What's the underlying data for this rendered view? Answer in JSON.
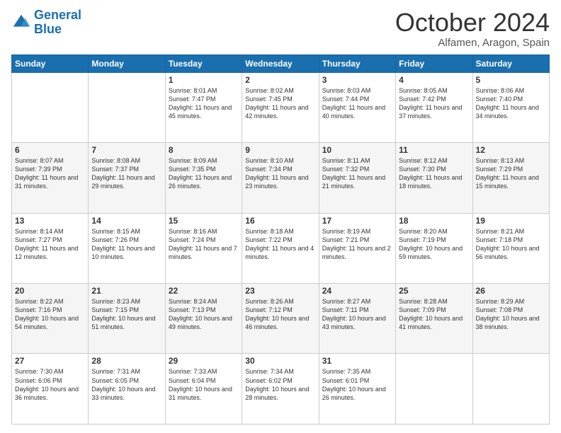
{
  "header": {
    "logo_general": "General",
    "logo_blue": "Blue",
    "month_title": "October 2024",
    "location": "Alfamen, Aragon, Spain"
  },
  "days_of_week": [
    "Sunday",
    "Monday",
    "Tuesday",
    "Wednesday",
    "Thursday",
    "Friday",
    "Saturday"
  ],
  "weeks": [
    [
      {
        "day": "",
        "info": ""
      },
      {
        "day": "",
        "info": ""
      },
      {
        "day": "1",
        "info": "Sunrise: 8:01 AM\nSunset: 7:47 PM\nDaylight: 11 hours and 45 minutes."
      },
      {
        "day": "2",
        "info": "Sunrise: 8:02 AM\nSunset: 7:45 PM\nDaylight: 11 hours and 42 minutes."
      },
      {
        "day": "3",
        "info": "Sunrise: 8:03 AM\nSunset: 7:44 PM\nDaylight: 11 hours and 40 minutes."
      },
      {
        "day": "4",
        "info": "Sunrise: 8:05 AM\nSunset: 7:42 PM\nDaylight: 11 hours and 37 minutes."
      },
      {
        "day": "5",
        "info": "Sunrise: 8:06 AM\nSunset: 7:40 PM\nDaylight: 11 hours and 34 minutes."
      }
    ],
    [
      {
        "day": "6",
        "info": "Sunrise: 8:07 AM\nSunset: 7:39 PM\nDaylight: 11 hours and 31 minutes."
      },
      {
        "day": "7",
        "info": "Sunrise: 8:08 AM\nSunset: 7:37 PM\nDaylight: 11 hours and 29 minutes."
      },
      {
        "day": "8",
        "info": "Sunrise: 8:09 AM\nSunset: 7:35 PM\nDaylight: 11 hours and 26 minutes."
      },
      {
        "day": "9",
        "info": "Sunrise: 8:10 AM\nSunset: 7:34 PM\nDaylight: 11 hours and 23 minutes."
      },
      {
        "day": "10",
        "info": "Sunrise: 8:11 AM\nSunset: 7:32 PM\nDaylight: 11 hours and 21 minutes."
      },
      {
        "day": "11",
        "info": "Sunrise: 8:12 AM\nSunset: 7:30 PM\nDaylight: 11 hours and 18 minutes."
      },
      {
        "day": "12",
        "info": "Sunrise: 8:13 AM\nSunset: 7:29 PM\nDaylight: 11 hours and 15 minutes."
      }
    ],
    [
      {
        "day": "13",
        "info": "Sunrise: 8:14 AM\nSunset: 7:27 PM\nDaylight: 11 hours and 12 minutes."
      },
      {
        "day": "14",
        "info": "Sunrise: 8:15 AM\nSunset: 7:26 PM\nDaylight: 11 hours and 10 minutes."
      },
      {
        "day": "15",
        "info": "Sunrise: 8:16 AM\nSunset: 7:24 PM\nDaylight: 11 hours and 7 minutes."
      },
      {
        "day": "16",
        "info": "Sunrise: 8:18 AM\nSunset: 7:22 PM\nDaylight: 11 hours and 4 minutes."
      },
      {
        "day": "17",
        "info": "Sunrise: 8:19 AM\nSunset: 7:21 PM\nDaylight: 11 hours and 2 minutes."
      },
      {
        "day": "18",
        "info": "Sunrise: 8:20 AM\nSunset: 7:19 PM\nDaylight: 10 hours and 59 minutes."
      },
      {
        "day": "19",
        "info": "Sunrise: 8:21 AM\nSunset: 7:18 PM\nDaylight: 10 hours and 56 minutes."
      }
    ],
    [
      {
        "day": "20",
        "info": "Sunrise: 8:22 AM\nSunset: 7:16 PM\nDaylight: 10 hours and 54 minutes."
      },
      {
        "day": "21",
        "info": "Sunrise: 8:23 AM\nSunset: 7:15 PM\nDaylight: 10 hours and 51 minutes."
      },
      {
        "day": "22",
        "info": "Sunrise: 8:24 AM\nSunset: 7:13 PM\nDaylight: 10 hours and 49 minutes."
      },
      {
        "day": "23",
        "info": "Sunrise: 8:26 AM\nSunset: 7:12 PM\nDaylight: 10 hours and 46 minutes."
      },
      {
        "day": "24",
        "info": "Sunrise: 8:27 AM\nSunset: 7:11 PM\nDaylight: 10 hours and 43 minutes."
      },
      {
        "day": "25",
        "info": "Sunrise: 8:28 AM\nSunset: 7:09 PM\nDaylight: 10 hours and 41 minutes."
      },
      {
        "day": "26",
        "info": "Sunrise: 8:29 AM\nSunset: 7:08 PM\nDaylight: 10 hours and 38 minutes."
      }
    ],
    [
      {
        "day": "27",
        "info": "Sunrise: 7:30 AM\nSunset: 6:06 PM\nDaylight: 10 hours and 36 minutes."
      },
      {
        "day": "28",
        "info": "Sunrise: 7:31 AM\nSunset: 6:05 PM\nDaylight: 10 hours and 33 minutes."
      },
      {
        "day": "29",
        "info": "Sunrise: 7:33 AM\nSunset: 6:04 PM\nDaylight: 10 hours and 31 minutes."
      },
      {
        "day": "30",
        "info": "Sunrise: 7:34 AM\nSunset: 6:02 PM\nDaylight: 10 hours and 28 minutes."
      },
      {
        "day": "31",
        "info": "Sunrise: 7:35 AM\nSunset: 6:01 PM\nDaylight: 10 hours and 26 minutes."
      },
      {
        "day": "",
        "info": ""
      },
      {
        "day": "",
        "info": ""
      }
    ]
  ]
}
